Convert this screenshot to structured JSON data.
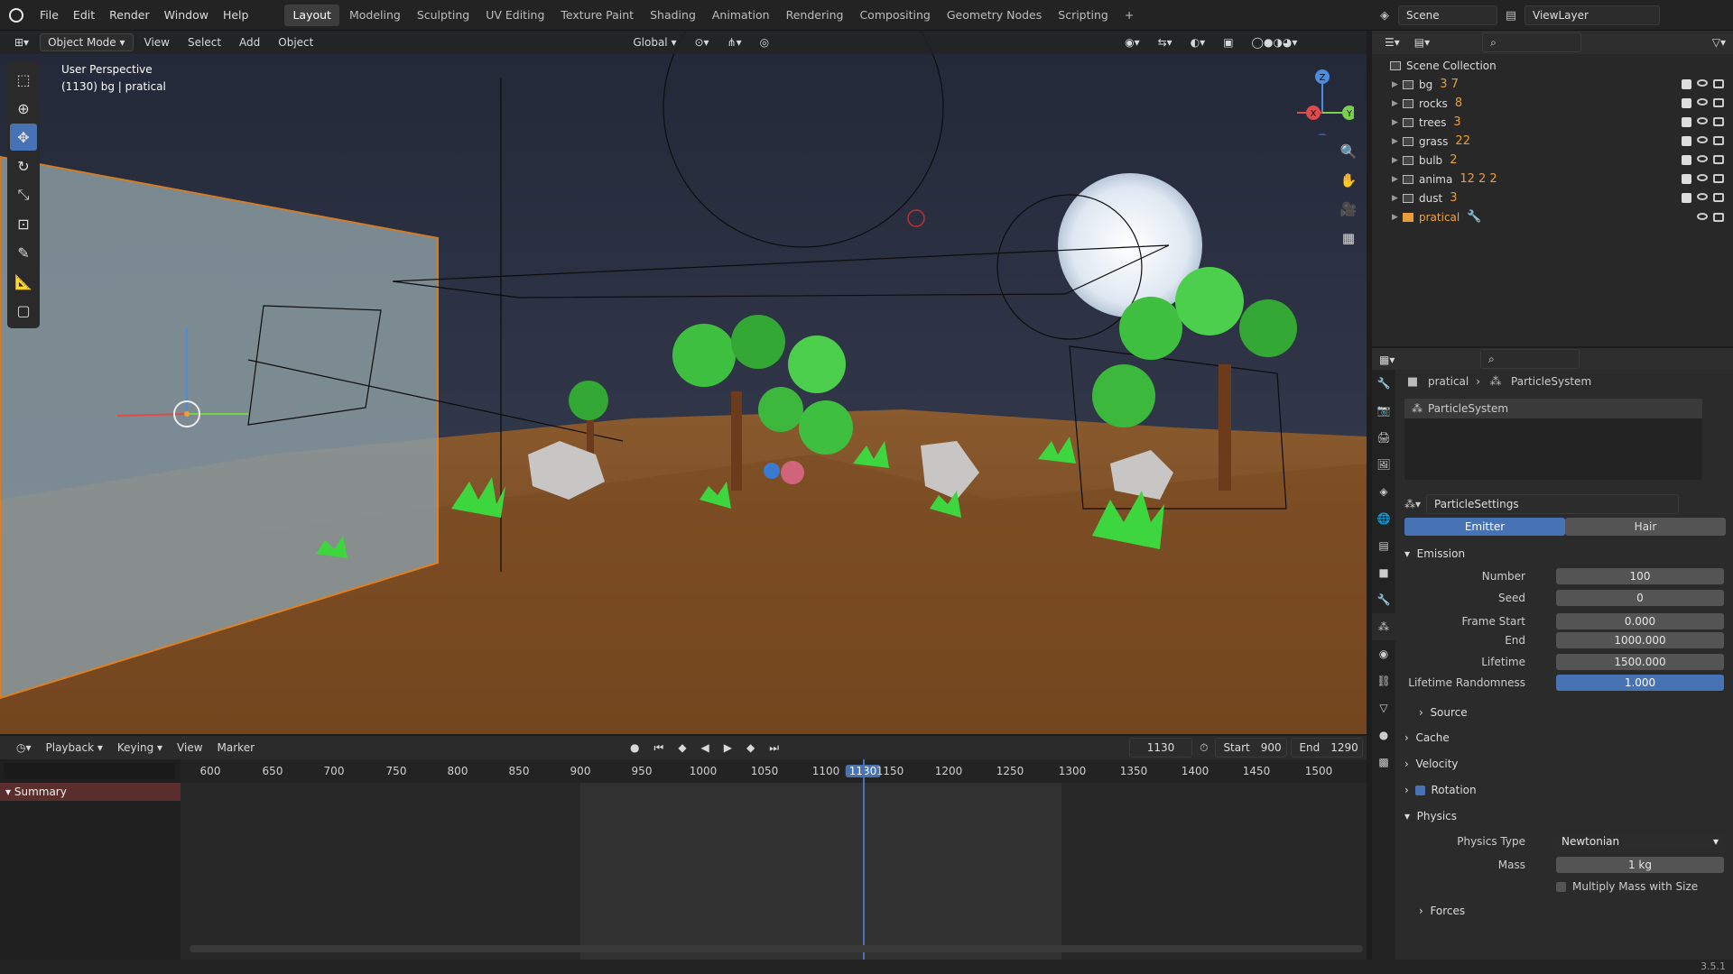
{
  "menubar": {
    "items": [
      "File",
      "Edit",
      "Render",
      "Window",
      "Help"
    ],
    "workspaces": [
      "Layout",
      "Modeling",
      "Sculpting",
      "UV Editing",
      "Texture Paint",
      "Shading",
      "Animation",
      "Rendering",
      "Compositing",
      "Geometry Nodes",
      "Scripting"
    ],
    "active_workspace": "Layout",
    "scene": "Scene",
    "view_layer": "ViewLayer"
  },
  "viewport": {
    "mode": "Object Mode",
    "menus": [
      "View",
      "Select",
      "Add",
      "Object"
    ],
    "orientation": "Global",
    "info_line1": "User Perspective",
    "info_line2": "(1130) bg | pratical",
    "gizmo_axes": [
      "Z",
      "X",
      "Y"
    ]
  },
  "timeline": {
    "menus": [
      "Playback",
      "Keying",
      "View",
      "Marker"
    ],
    "current_frame": "1130",
    "start_label": "Start",
    "start": "900",
    "end_label": "End",
    "end": "1290",
    "ruler": [
      "600",
      "650",
      "700",
      "750",
      "800",
      "850",
      "900",
      "950",
      "1000",
      "1050",
      "1100",
      "1130",
      "1150",
      "1200",
      "1250",
      "1300",
      "1350",
      "1400",
      "1450",
      "1500"
    ],
    "summary": "Summary"
  },
  "outliner": {
    "root": "Scene Collection",
    "rows": [
      {
        "name": "bg",
        "counts": "3 7"
      },
      {
        "name": "rocks",
        "counts": "8"
      },
      {
        "name": "trees",
        "counts": "3"
      },
      {
        "name": "grass",
        "counts": "22"
      },
      {
        "name": "bulb",
        "counts": "2"
      },
      {
        "name": "anima",
        "counts": "12 2 2"
      },
      {
        "name": "dust",
        "counts": "3"
      },
      {
        "name": "pratical",
        "counts": ""
      }
    ]
  },
  "properties": {
    "breadcrumb_object": "pratical",
    "breadcrumb_system": "ParticleSystem",
    "system_name": "ParticleSystem",
    "settings_name": "ParticleSettings",
    "tab_emitter": "Emitter",
    "tab_hair": "Hair",
    "emission_title": "Emission",
    "fields": [
      {
        "label": "Number",
        "value": "100"
      },
      {
        "label": "Seed",
        "value": "0"
      },
      {
        "label": "Frame Start",
        "value": "0.000"
      },
      {
        "label": "End",
        "value": "1000.000"
      },
      {
        "label": "Lifetime",
        "value": "1500.000"
      },
      {
        "label": "Lifetime Randomness",
        "value": "1.000"
      }
    ],
    "source": "Source",
    "cache": "Cache",
    "velocity": "Velocity",
    "rotation": "Rotation",
    "physics": "Physics",
    "physics_type_label": "Physics Type",
    "physics_type": "Newtonian",
    "mass_label": "Mass",
    "mass": "1 kg",
    "multiply_mass": "Multiply Mass with Size",
    "forces": "Forces"
  },
  "status": {
    "version": "3.5.1"
  }
}
